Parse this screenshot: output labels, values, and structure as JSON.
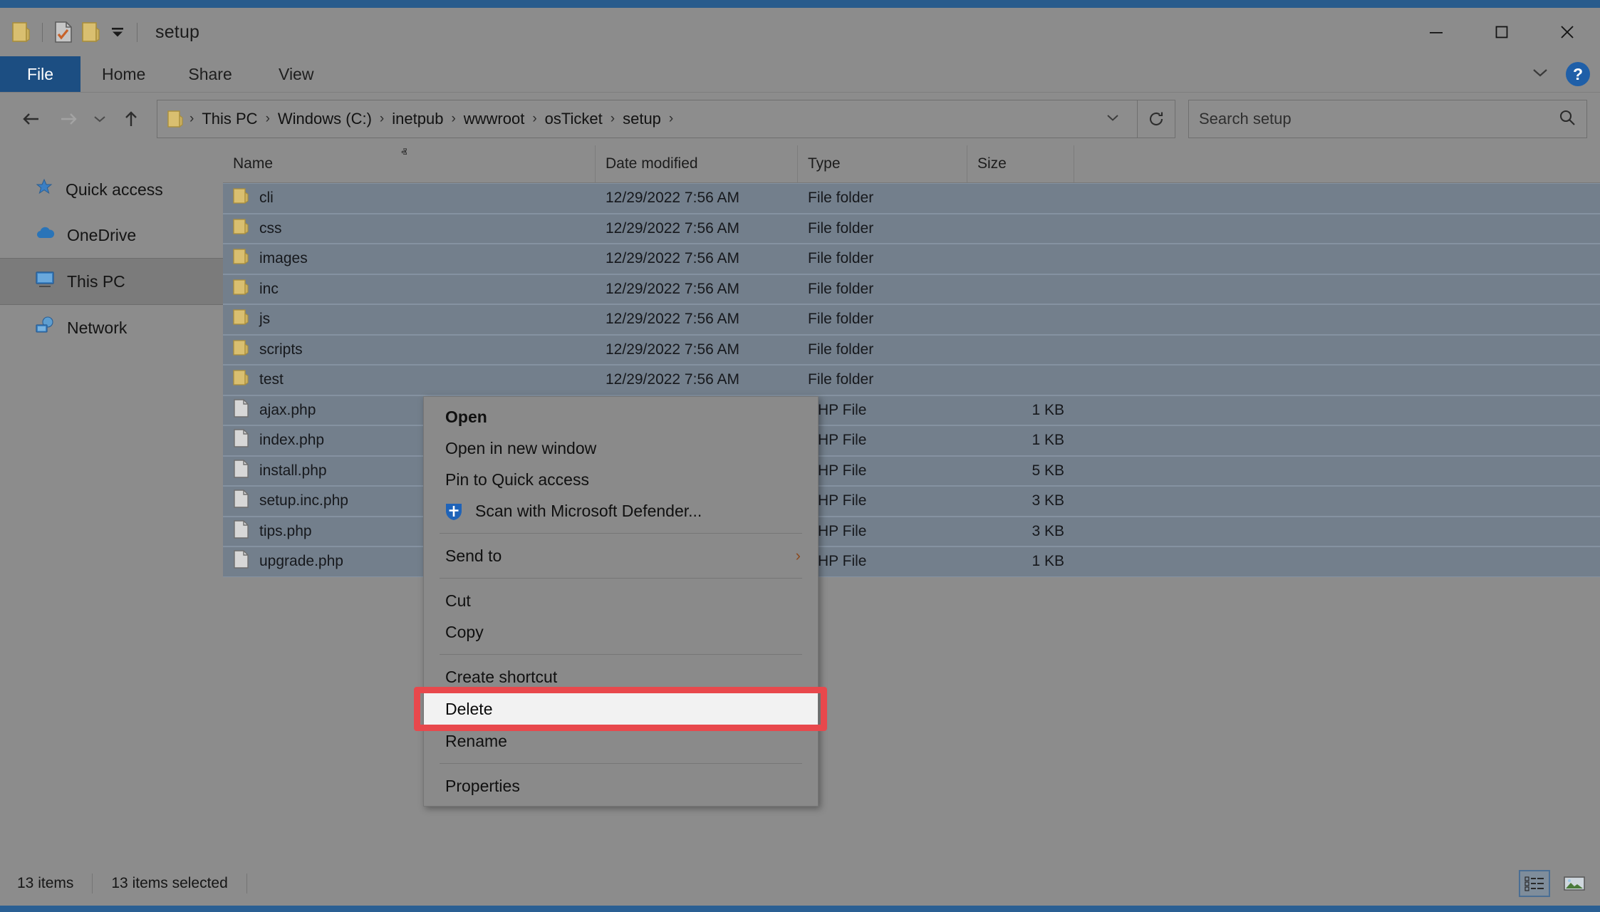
{
  "window": {
    "title": "setup",
    "quick_access": [
      {
        "name": "folder-icon",
        "label": "Folder"
      },
      {
        "name": "properties-icon",
        "label": "Properties"
      },
      {
        "name": "new-folder-icon",
        "label": "New folder"
      },
      {
        "name": "customize-qat-chevron-icon",
        "label": "Customize Quick Access Toolbar"
      }
    ],
    "controls": {
      "minimize": "Minimize",
      "maximize": "Maximize",
      "close": "Close"
    }
  },
  "ribbon": {
    "tabs": [
      {
        "label": "File",
        "active": true
      },
      {
        "label": "Home",
        "active": false
      },
      {
        "label": "Share",
        "active": false
      },
      {
        "label": "View",
        "active": false
      }
    ],
    "collapse_label": "Minimize the Ribbon",
    "help_label": "?"
  },
  "navbar": {
    "back": "Back",
    "forward": "Forward",
    "recent": "Recent locations",
    "up": "Up",
    "breadcrumbs": [
      "This PC",
      "Windows (C:)",
      "inetpub",
      "wwwroot",
      "osTicket",
      "setup"
    ],
    "breadcrumb_separator": "›",
    "history_dropdown": "∨",
    "refresh": "Refresh",
    "search": {
      "placeholder": "Search setup",
      "value": ""
    }
  },
  "sidebar": {
    "items": [
      {
        "label": "Quick access",
        "icon": "pin-star-icon",
        "selected": false
      },
      {
        "label": "OneDrive",
        "icon": "cloud-icon",
        "selected": false
      },
      {
        "label": "This PC",
        "icon": "monitor-icon",
        "selected": true
      },
      {
        "label": "Network",
        "icon": "network-icon",
        "selected": false
      }
    ]
  },
  "filelist": {
    "columns": [
      "Name",
      "Date modified",
      "Type",
      "Size"
    ],
    "sort_column": "Name",
    "sort_caret": "ⱏ",
    "rows": [
      {
        "name": "cli",
        "date": "12/29/2022 7:56 AM",
        "type": "File folder",
        "size": "",
        "kind": "folder",
        "selected": true
      },
      {
        "name": "css",
        "date": "12/29/2022 7:56 AM",
        "type": "File folder",
        "size": "",
        "kind": "folder",
        "selected": true
      },
      {
        "name": "images",
        "date": "12/29/2022 7:56 AM",
        "type": "File folder",
        "size": "",
        "kind": "folder",
        "selected": true
      },
      {
        "name": "inc",
        "date": "12/29/2022 7:56 AM",
        "type": "File folder",
        "size": "",
        "kind": "folder",
        "selected": true
      },
      {
        "name": "js",
        "date": "12/29/2022 7:56 AM",
        "type": "File folder",
        "size": "",
        "kind": "folder",
        "selected": true
      },
      {
        "name": "scripts",
        "date": "12/29/2022 7:56 AM",
        "type": "File folder",
        "size": "",
        "kind": "folder",
        "selected": true
      },
      {
        "name": "test",
        "date": "12/29/2022 7:56 AM",
        "type": "File folder",
        "size": "",
        "kind": "folder",
        "selected": true
      },
      {
        "name": "ajax.php",
        "date": "",
        "type": "PHP File",
        "size": "1 KB",
        "kind": "file",
        "selected": true
      },
      {
        "name": "index.php",
        "date": "",
        "type": "PHP File",
        "size": "1 KB",
        "kind": "file",
        "selected": true
      },
      {
        "name": "install.php",
        "date": "",
        "type": "PHP File",
        "size": "5 KB",
        "kind": "file",
        "selected": true
      },
      {
        "name": "setup.inc.php",
        "date": "",
        "type": "PHP File",
        "size": "3 KB",
        "kind": "file",
        "selected": true
      },
      {
        "name": "tips.php",
        "date": "",
        "type": "PHP File",
        "size": "3 KB",
        "kind": "file",
        "selected": true
      },
      {
        "name": "upgrade.php",
        "date": "",
        "type": "PHP File",
        "size": "1 KB",
        "kind": "file",
        "selected": true
      }
    ]
  },
  "context_menu": {
    "items": [
      {
        "label": "Open",
        "bold": true,
        "icon": null,
        "submenu": false
      },
      {
        "label": "Open in new window",
        "bold": false,
        "icon": null,
        "submenu": false
      },
      {
        "label": "Pin to Quick access",
        "bold": false,
        "icon": null,
        "submenu": false
      },
      {
        "label": "Scan with Microsoft Defender...",
        "bold": false,
        "icon": "defender-shield-icon",
        "submenu": false
      },
      {
        "separator": true
      },
      {
        "label": "Send to",
        "bold": false,
        "icon": null,
        "submenu": true,
        "submenu_arrow": "›"
      },
      {
        "separator": true
      },
      {
        "label": "Cut",
        "bold": false,
        "icon": null,
        "submenu": false
      },
      {
        "label": "Copy",
        "bold": false,
        "icon": null,
        "submenu": false
      },
      {
        "separator": true
      },
      {
        "label": "Create shortcut",
        "bold": false,
        "icon": null,
        "submenu": false
      },
      {
        "label": "Delete",
        "bold": false,
        "icon": null,
        "submenu": false,
        "highlighted": true
      },
      {
        "label": "Rename",
        "bold": false,
        "icon": null,
        "submenu": false
      },
      {
        "separator": true
      },
      {
        "label": "Properties",
        "bold": false,
        "icon": null,
        "submenu": false
      }
    ]
  },
  "statusbar": {
    "item_count": "13 items",
    "selected_count": "13 items selected",
    "views": [
      {
        "name": "details-view-icon",
        "label": "Details view",
        "active": true
      },
      {
        "name": "large-icons-view-icon",
        "label": "Large icons view",
        "active": false
      }
    ]
  },
  "colors": {
    "accent_blue": "#285b8c",
    "file_tab_blue": "#1c4e82",
    "window_bg": "#8c8c8c",
    "selection": "#737f8c",
    "highlight_red": "#e8484c",
    "menu_bg": "#8a8a8a",
    "delete_row_bg": "#f2f2f2"
  }
}
